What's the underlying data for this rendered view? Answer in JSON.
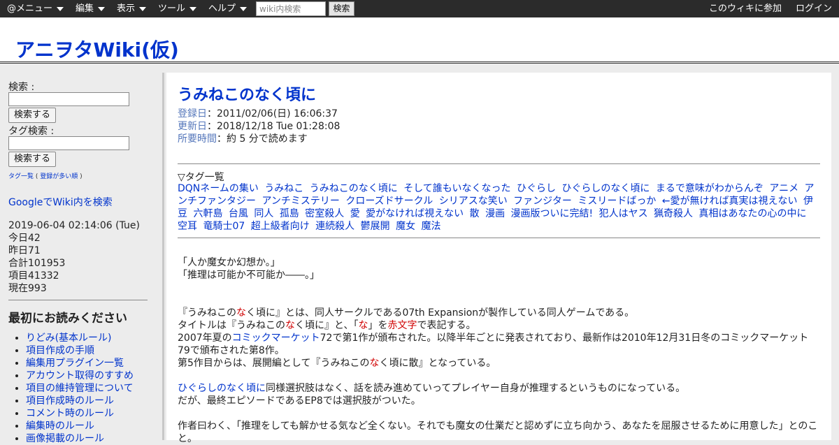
{
  "topbar": {
    "menus": [
      "@メニュー",
      "編集",
      "表示",
      "ツール",
      "ヘルプ"
    ],
    "search_placeholder": "wiki内検索",
    "search_button": "検索",
    "join_link": "このウィキに参加",
    "login_link": "ログイン"
  },
  "header": {
    "site_title": "アニヲタWiki(仮)"
  },
  "sidebar": {
    "search_label": "検索 :",
    "search_button": "検索する",
    "tag_search_label": "タグ検索 :",
    "tag_search_button": "検索する",
    "tag_list_link": "タグ一覧",
    "tag_list_paren_open": "(",
    "tag_popular_link": "登録が多い順",
    "tag_list_paren_close": ")",
    "google_link": "GoogleでWiki内を検索",
    "stats": [
      "2019-06-04 02:14:06 (Tue)",
      "今日42",
      "昨日71",
      "合計101953",
      "項目41332",
      "現在993"
    ],
    "section_title": "最初にお読みください",
    "nav_items": [
      "りどみ(基本ルール)",
      "項目作成の手順",
      "編集用プラグイン一覧",
      "アカウント取得のすすめ",
      "項目の維持管理について",
      "項目作成時のルール",
      "コメント時のルール",
      "編集時のルール",
      "画像掲載のルール"
    ]
  },
  "article": {
    "title": "うみねこのなく頃に",
    "registered_label": "登録日",
    "registered_value": "：2011/02/06(日) 16:06:37",
    "updated_label": "更新日",
    "updated_value": "：2018/12/18 Tue 01:28:08",
    "reading_label": "所要時間",
    "reading_value": "：約 5 分で読めます",
    "tags_heading": "▽タグ一覧",
    "tags": [
      "DQNネームの集い",
      "うみねこ",
      "うみねこのなく頃に",
      "そして誰もいなくなった",
      "ひぐらし",
      "ひぐらしのなく頃に",
      "まるで意味がわからんぞ",
      "アニメ",
      "アンチファンタジー",
      "アンチミステリー",
      "クローズドサークル",
      "シリアスな笑い",
      "ファンジター",
      "ミスリードばっか",
      "←愛が無ければ真実は視えない",
      "伊豆",
      "六軒島",
      "台風",
      "同人",
      "孤島",
      "密室殺人",
      "愛",
      "愛がなければ視えない",
      "散",
      "漫画",
      "漫画版ついに完結!",
      "犯人はヤス",
      "猟奇殺人",
      "真相はあなたの心の中に",
      "空耳",
      "竜騎士07",
      "超上級者向け",
      "連続殺人",
      "鬱展開",
      "魔女",
      "魔法"
    ],
    "quote1": "「人か魔女か幻想か。」",
    "quote2": "「推理は可能か不可能か――。」",
    "p1_a": "『うみねこの",
    "p1_red": "な",
    "p1_b": "く頃に』とは、同人サークルである07th Expansionが製作している同人ゲームである。",
    "p2_a": "タイトルは『うみねこの",
    "p2_red": "な",
    "p2_b": "く頃に』と、「",
    "p2_red2": "な",
    "p2_c": "」を",
    "p2_red3": "赤文字",
    "p2_d": "で表記する。",
    "p3_a": "2007年夏の",
    "p3_link": "コミックマーケット",
    "p3_b": "72で第1作が頒布された。以降半年ごとに発表されており、最新作は2010年12月31日冬のコミックマーケット79で頒布された第8作。",
    "p4_a": "第5作目からは、展開編として『うみねこの",
    "p4_red": "な",
    "p4_b": "く頃に散』となっている。",
    "p5_link": "ひぐらしのなく頃に",
    "p5_b": "同様選択肢はなく、話を読み進めていってプレイヤー自身が推理するというものになっている。",
    "p6": "だが、最終エピソードであるEP8では選択肢がついた。",
    "p7": "作者曰わく、「推理をしても解かせる気など全くない。それでも魔女の仕業だと認めずに立ち向かう、あなたを屈服させるために用意した」とのこと。",
    "colors": {
      "link": "#0033cc",
      "red_text": "#d00000",
      "meta_label": "#5577bb"
    }
  }
}
